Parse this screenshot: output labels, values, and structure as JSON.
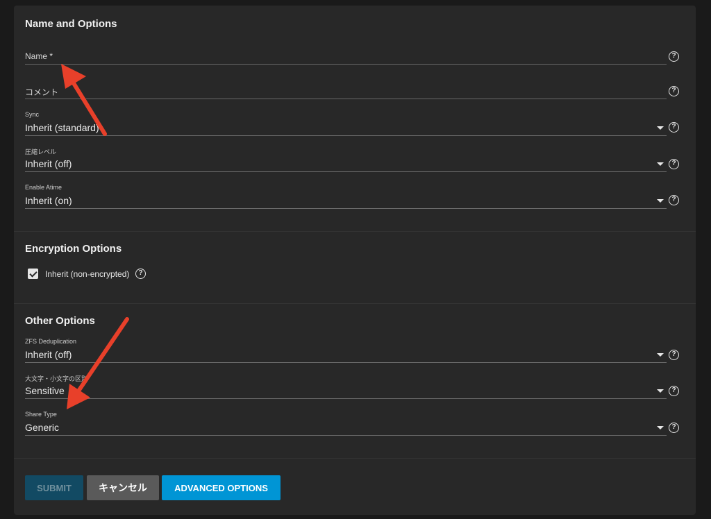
{
  "sections": {
    "name_options": {
      "title": "Name and Options",
      "fields": {
        "name": {
          "label": "Name *"
        },
        "comment": {
          "label": "コメント"
        },
        "sync": {
          "label": "Sync",
          "value": "Inherit (standard)"
        },
        "compression": {
          "label": "圧縮レベル",
          "value": "Inherit (off)"
        },
        "atime": {
          "label": "Enable Atime",
          "value": "Inherit (on)"
        }
      }
    },
    "encryption": {
      "title": "Encryption Options",
      "inherit_label": "Inherit (non-encrypted)",
      "inherit_checked": true
    },
    "other": {
      "title": "Other Options",
      "fields": {
        "dedup": {
          "label": "ZFS Deduplication",
          "value": "Inherit (off)"
        },
        "case": {
          "label": "大文字・小文字の区別",
          "value": "Sensitive"
        },
        "share_type": {
          "label": "Share Type",
          "value": "Generic"
        }
      }
    }
  },
  "buttons": {
    "submit": "SUBMIT",
    "cancel": "キャンセル",
    "advanced": "ADVANCED OPTIONS"
  },
  "icons": {
    "help": "help-circle-icon",
    "dropdown": "caret-down-icon",
    "annotation": "red-arrow"
  },
  "colors": {
    "background": "#1a1a1a",
    "card": "#282828",
    "accent": "#0095d5",
    "submit_disabled": "#124a63",
    "cancel": "#5a5a5a",
    "annotation_arrow": "#e8402a"
  }
}
